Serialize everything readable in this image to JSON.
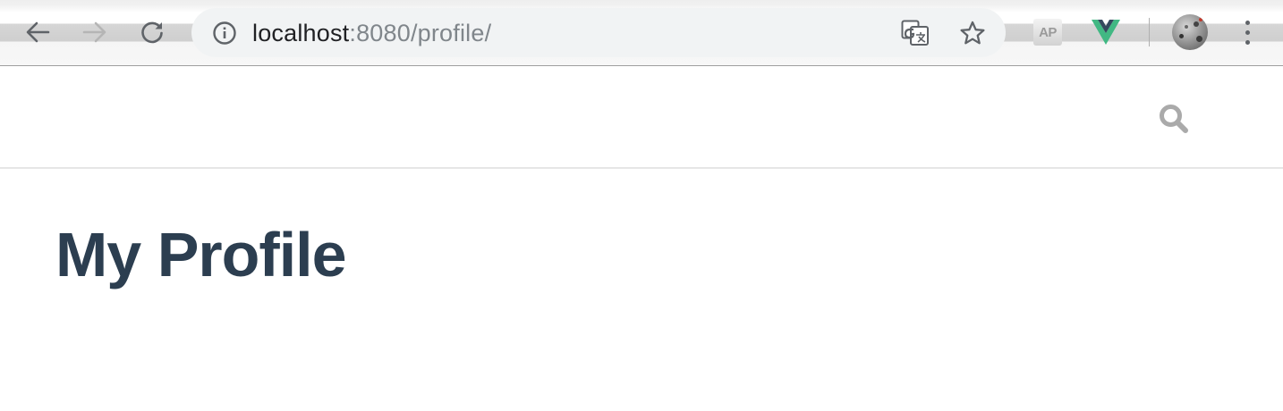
{
  "browser": {
    "address_bar": {
      "host": "localhost",
      "rest": ":8080/profile/"
    },
    "toolbar_icons": {
      "back": "arrow-left-icon",
      "forward": "arrow-right-icon",
      "reload": "reload-icon",
      "site_info": "info-icon",
      "translate": "translate-icon",
      "bookmark": "star-icon",
      "menu": "vertical-dots-icon"
    },
    "extensions": {
      "ap_label": "AP",
      "vue_devtools": "vue-logo-icon"
    }
  },
  "site": {
    "header": {
      "search_icon": "magnifier-icon"
    }
  },
  "page": {
    "title": "My Profile"
  },
  "colors": {
    "title": "#2c3e50",
    "search_icon": "#aaaaaa",
    "vue_green": "#41b883",
    "vue_dark": "#35495e",
    "header_border": "#e6e6e6"
  }
}
